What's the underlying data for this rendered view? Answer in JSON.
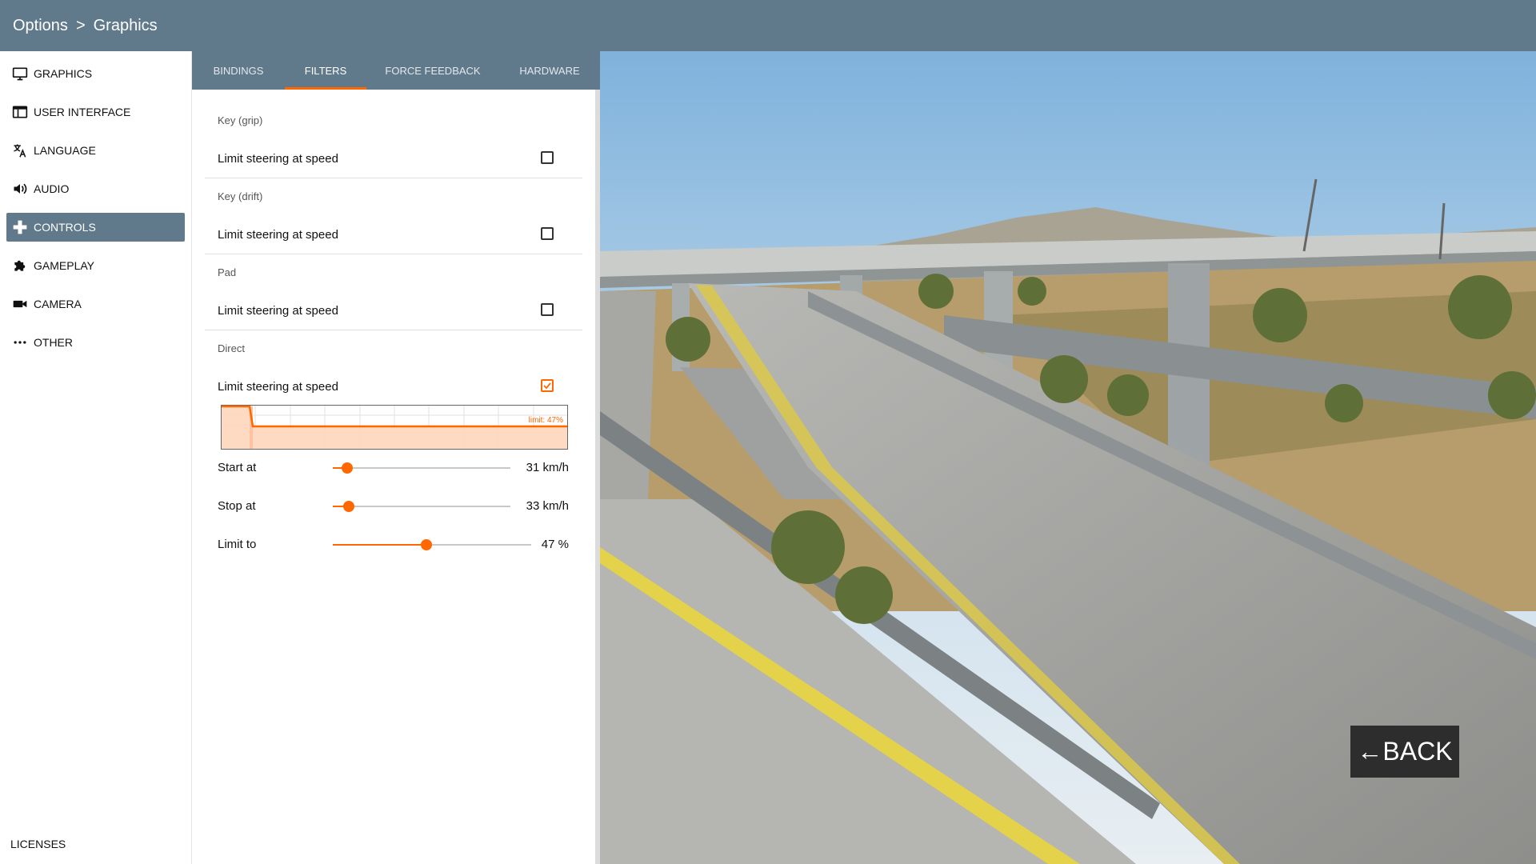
{
  "breadcrumb": {
    "root": "Options",
    "separator": ">",
    "current": "Graphics"
  },
  "sidebar": {
    "items": [
      {
        "label": "GRAPHICS",
        "icon": "monitor-icon",
        "active": false
      },
      {
        "label": "USER INTERFACE",
        "icon": "window-icon",
        "active": false
      },
      {
        "label": "LANGUAGE",
        "icon": "translate-icon",
        "active": false
      },
      {
        "label": "AUDIO",
        "icon": "speaker-icon",
        "active": false
      },
      {
        "label": "CONTROLS",
        "icon": "gamepad-icon",
        "active": true
      },
      {
        "label": "GAMEPLAY",
        "icon": "puzzle-icon",
        "active": false
      },
      {
        "label": "CAMERA",
        "icon": "video-camera-icon",
        "active": false
      },
      {
        "label": "OTHER",
        "icon": "more-icon",
        "active": false
      }
    ],
    "licenses": "LICENSES"
  },
  "tabs": [
    {
      "label": "BINDINGS",
      "active": false
    },
    {
      "label": "FILTERS",
      "active": true
    },
    {
      "label": "FORCE FEEDBACK",
      "active": false
    },
    {
      "label": "HARDWARE",
      "active": false
    }
  ],
  "filters": {
    "sections": [
      {
        "title": "Key (grip)",
        "option": "Limit steering at speed",
        "checked": false
      },
      {
        "title": "Key (drift)",
        "option": "Limit steering at speed",
        "checked": false
      },
      {
        "title": "Pad",
        "option": "Limit steering at speed",
        "checked": false
      },
      {
        "title": "Direct",
        "option": "Limit steering at speed",
        "checked": true
      }
    ],
    "graph_label": "limit: 47%",
    "sliders": [
      {
        "label": "Start at",
        "value": "31 km/h",
        "fraction": 0.08
      },
      {
        "label": "Stop at",
        "value": "33 km/h",
        "fraction": 0.09
      },
      {
        "label": "Limit to",
        "value": "47 %",
        "fraction": 0.47
      }
    ]
  },
  "back_button": {
    "arrow": "←",
    "label": "BACK"
  },
  "colors": {
    "accent": "#ff6700",
    "header": "#617a8b",
    "active_item": "#617a8b"
  }
}
